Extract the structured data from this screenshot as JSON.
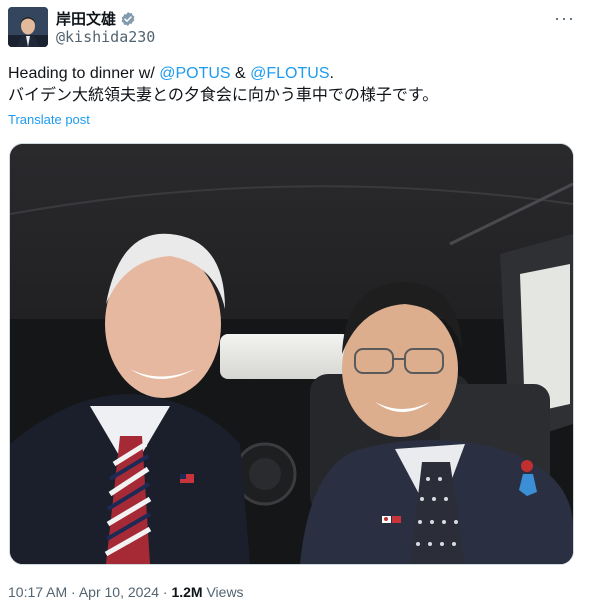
{
  "author": {
    "display_name": "岸田文雄",
    "handle": "@kishida230",
    "verified_color": "#829aab"
  },
  "more_label": "···",
  "tweet": {
    "line1_prefix": "Heading to dinner w/ ",
    "mention1": "@POTUS",
    "line1_mid": " & ",
    "mention2": "@FLOTUS",
    "line1_suffix": ".",
    "line2": "バイデン大統領夫妻との夕食会に向かう車中での様子です。"
  },
  "translate_label": "Translate post",
  "meta": {
    "time": "10:17 AM",
    "sep1": " · ",
    "date": "Apr 10, 2024",
    "sep2": " · ",
    "views_count": "1.2M",
    "views_label": " Views"
  },
  "colors": {
    "link": "#1d9bf0",
    "secondary_text": "#536471"
  }
}
